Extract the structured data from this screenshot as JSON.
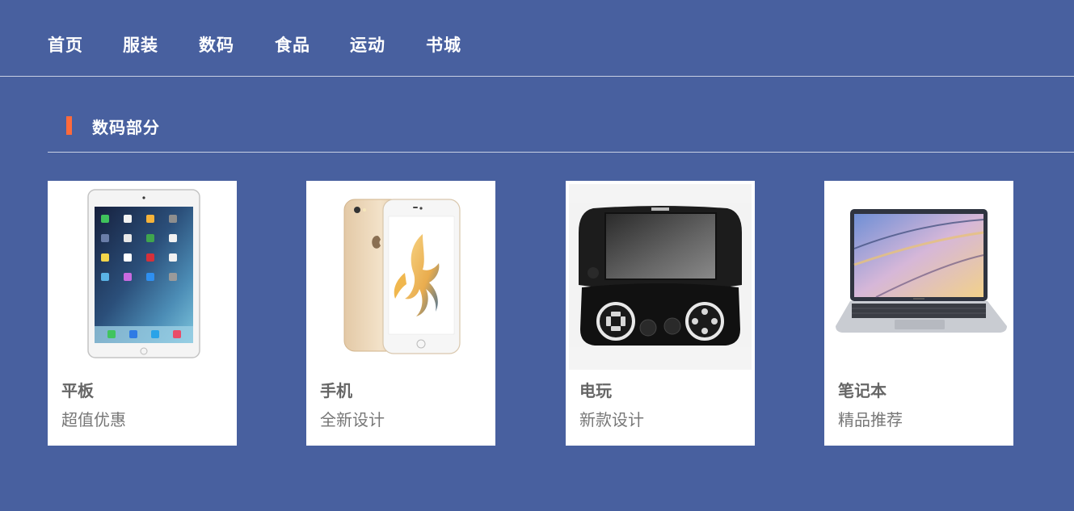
{
  "nav": {
    "items": [
      {
        "label": "首页"
      },
      {
        "label": "服装"
      },
      {
        "label": "数码"
      },
      {
        "label": "食品"
      },
      {
        "label": "运动"
      },
      {
        "label": "书城"
      }
    ]
  },
  "section": {
    "title": "数码部分"
  },
  "products": [
    {
      "name": "平板",
      "desc": "超值优惠",
      "icon": "tablet-image"
    },
    {
      "name": "手机",
      "desc": "全新设计",
      "icon": "phone-image"
    },
    {
      "name": "电玩",
      "desc": "新款设计",
      "icon": "game-console-image"
    },
    {
      "name": "笔记本",
      "desc": "精品推荐",
      "icon": "laptop-image"
    }
  ],
  "colors": {
    "background": "#48609f",
    "accent": "#ff6a3b",
    "card": "#ffffff"
  }
}
